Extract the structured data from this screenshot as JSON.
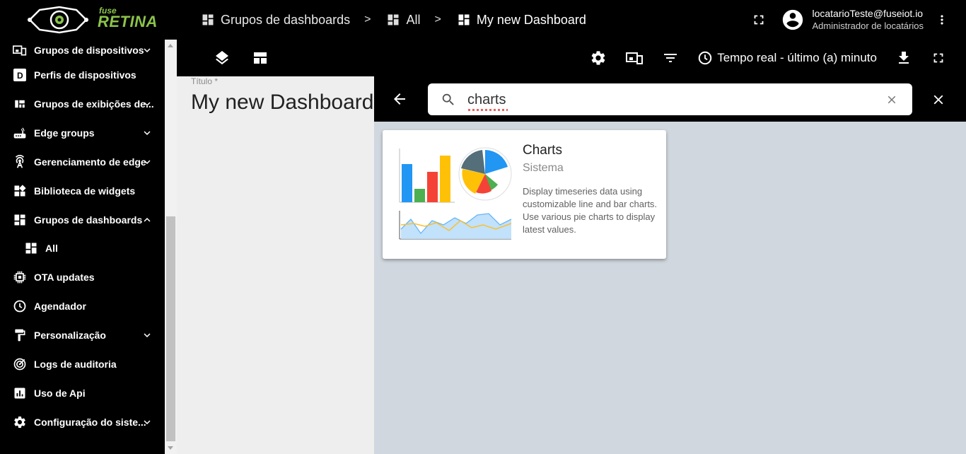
{
  "brand": {
    "line1": "fuse",
    "line2": "RETINA"
  },
  "breadcrumbs": [
    {
      "label": "Grupos de dashboards"
    },
    {
      "label": "All"
    },
    {
      "label": "My new Dashboard"
    }
  ],
  "breadcrumb_separator": ">",
  "user": {
    "email": "locatarioTeste@fuseiot.io",
    "role": "Administrador de locatários"
  },
  "sidebar": {
    "items": [
      {
        "label": "Grupos de dispositivos",
        "icon": "devices-group-icon",
        "expandable": true
      },
      {
        "label": "Perfis de dispositivos",
        "icon": "device-profile-icon",
        "expandable": false
      },
      {
        "label": "Grupos de exibições de...",
        "icon": "view-groups-icon",
        "expandable": true
      },
      {
        "label": "Edge groups",
        "icon": "router-icon",
        "expandable": true
      },
      {
        "label": "Gerenciamento de edge",
        "icon": "antenna-icon",
        "expandable": true
      },
      {
        "label": "Biblioteca de widgets",
        "icon": "widgets-icon",
        "expandable": false
      },
      {
        "label": "Grupos de dashboards",
        "icon": "dashboard-icon",
        "expandable": true,
        "expanded": true
      },
      {
        "label": "All",
        "icon": "dashboard-icon",
        "sub": true
      },
      {
        "label": "OTA updates",
        "icon": "chip-icon",
        "expandable": false
      },
      {
        "label": "Agendador",
        "icon": "clock-icon",
        "expandable": false
      },
      {
        "label": "Personalização",
        "icon": "paint-roller-icon",
        "expandable": true
      },
      {
        "label": "Logs de auditoria",
        "icon": "track-changes-icon",
        "expandable": false
      },
      {
        "label": "Uso de Api",
        "icon": "bar-chart-icon",
        "expandable": false
      },
      {
        "label": "Configuração do siste...",
        "icon": "gear-icon",
        "expandable": true
      }
    ]
  },
  "toolbar": {
    "time_window": "Tempo real - último (a) minuto"
  },
  "dashboard": {
    "title_label": "Título *",
    "title": "My new Dashboard"
  },
  "search": {
    "query": "charts"
  },
  "widget_results": [
    {
      "title": "Charts",
      "subtitle": "Sistema",
      "description": "Display timeseries data using customizable line and bar charts. Use various pie charts to display latest values."
    }
  ],
  "colors": {
    "brand_green": "#8bc34a",
    "panel_bg": "#d0d7de",
    "canvas_bg": "#eeeeee"
  }
}
